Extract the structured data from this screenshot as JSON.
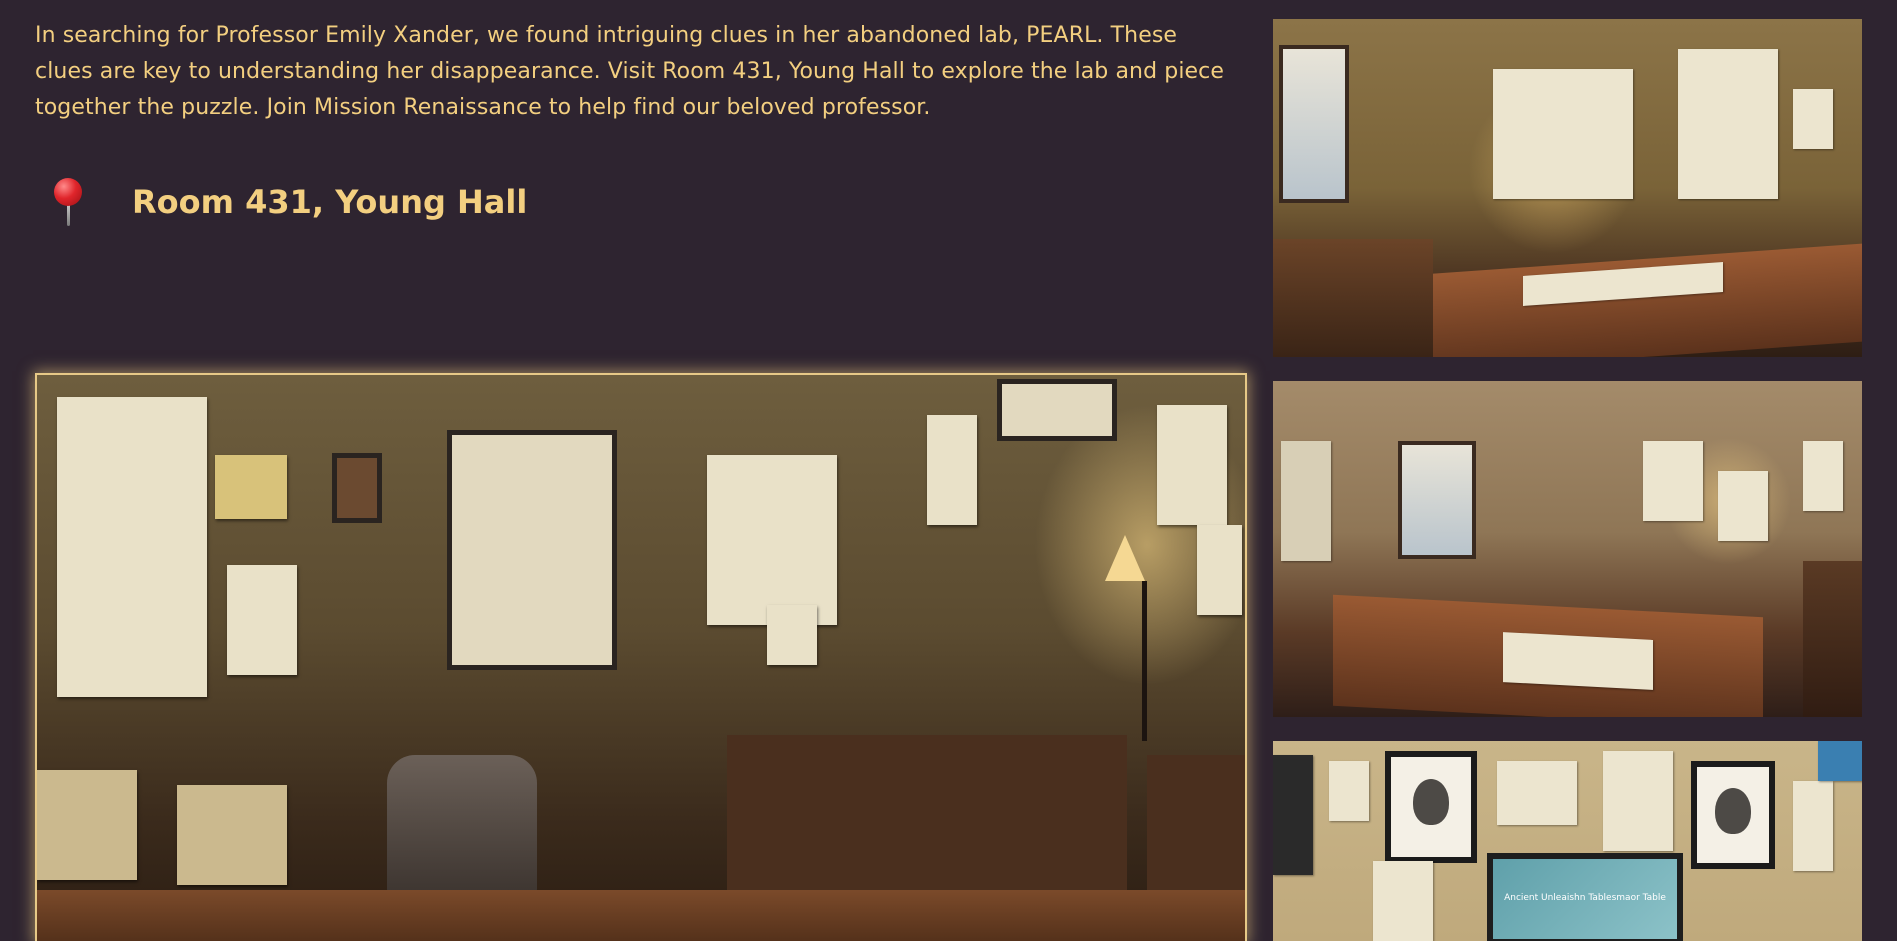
{
  "intro": {
    "text": "In searching for Professor Emily Xander, we found intriguing clues in her abandoned lab, PEARL. These clues are key to understanding her disappearance. Visit Room 431, Young Hall to explore the lab and piece together the puzzle. Join Mission Renaissance to help find our beloved professor."
  },
  "location": {
    "icon": "pushpin-icon",
    "name": "Room 431, Young Hall"
  },
  "colors": {
    "background": "#2e2430",
    "accent_text": "#f3cf80",
    "highlight_border": "#e7c987"
  },
  "gallery": {
    "main_image": "lab-room-main-photo",
    "side_images": [
      "lab-desk-photo",
      "lab-office-photo",
      "lab-wall-photo"
    ],
    "side3_screen_text": "Ancient Unleaishn Tablesmaor Table"
  }
}
